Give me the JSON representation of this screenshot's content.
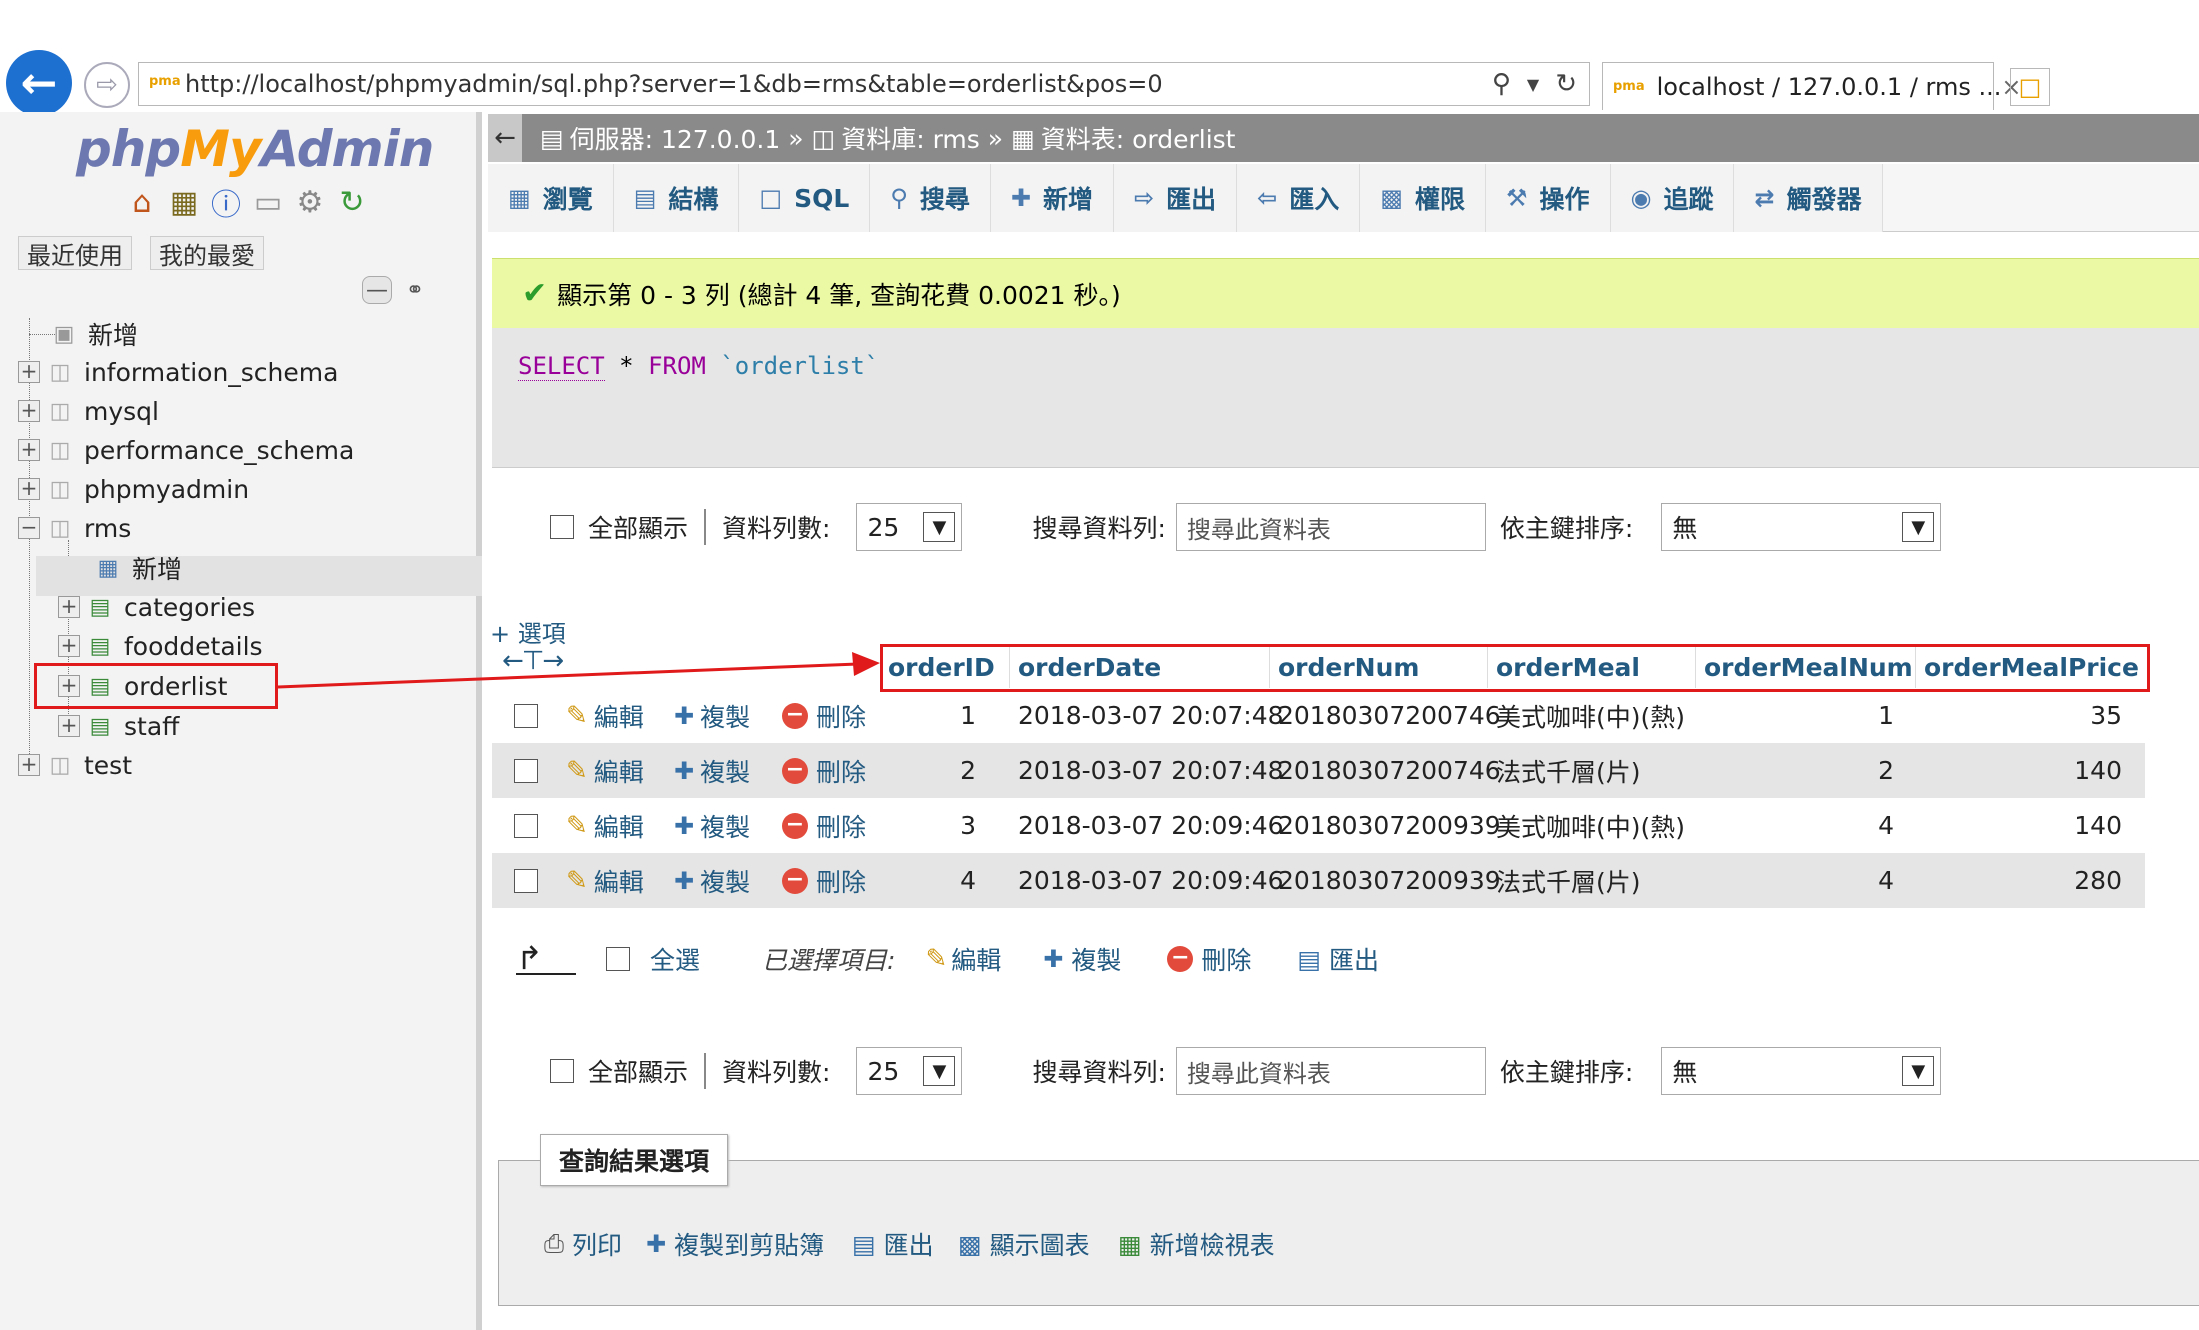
{
  "browser": {
    "url": "http://localhost/phpmyadmin/sql.php?server=1&db=rms&table=orderlist&pos=0",
    "tab_title": "localhost / 127.0.0.1 / rms ...",
    "tab_close": "×"
  },
  "nav": {
    "logo_php": "php",
    "logo_my": "My",
    "logo_admin": "Admin",
    "recent": "最近使用",
    "favorites": "我的最愛",
    "tree": [
      {
        "label": "新增"
      },
      {
        "label": "information_schema"
      },
      {
        "label": "mysql"
      },
      {
        "label": "performance_schema"
      },
      {
        "label": "phpmyadmin"
      },
      {
        "label": "rms"
      },
      {
        "label": "新增"
      },
      {
        "label": "categories"
      },
      {
        "label": "fooddetails"
      },
      {
        "label": "orderlist"
      },
      {
        "label": "staff"
      },
      {
        "label": "test"
      }
    ]
  },
  "breadcrumb": {
    "server": "伺服器: 127.0.0.1",
    "database": "資料庫: rms",
    "table": "資料表: orderlist",
    "sep": "»"
  },
  "tabs": [
    "瀏覽",
    "結構",
    "SQL",
    "搜尋",
    "新增",
    "匯出",
    "匯入",
    "權限",
    "操作",
    "追蹤",
    "觸發器"
  ],
  "message": "顯示第 0 - 3 列 (總計 4 筆, 查詢花費 0.0021 秒。)",
  "sql": {
    "select": "SELECT",
    "star": " * ",
    "from": "FROM",
    "table": " `orderlist`"
  },
  "controls": {
    "show_all": "全部顯示",
    "rows_label": "資料列數:",
    "rows_value": "25",
    "search_label": "搜尋資料列:",
    "search_placeholder": "搜尋此資料表",
    "sort_label": "依主鍵排序:",
    "sort_value": "無"
  },
  "options_link": "+ 選項",
  "columns": [
    "orderID",
    "orderDate",
    "orderNum",
    "orderMeal",
    "orderMealNum",
    "orderMealPrice"
  ],
  "row_actions": {
    "edit": "編輯",
    "copy": "複製",
    "delete": "刪除"
  },
  "rows": [
    {
      "orderID": "1",
      "orderDate": "2018-03-07 20:07:48",
      "orderNum": "20180307200746",
      "orderMeal": "美式咖啡(中)(熱)",
      "orderMealNum": "1",
      "orderMealPrice": "35"
    },
    {
      "orderID": "2",
      "orderDate": "2018-03-07 20:07:48",
      "orderNum": "20180307200746",
      "orderMeal": "法式千層(片)",
      "orderMealNum": "2",
      "orderMealPrice": "140"
    },
    {
      "orderID": "3",
      "orderDate": "2018-03-07 20:09:46",
      "orderNum": "20180307200939",
      "orderMeal": "美式咖啡(中)(熱)",
      "orderMealNum": "4",
      "orderMealPrice": "140"
    },
    {
      "orderID": "4",
      "orderDate": "2018-03-07 20:09:46",
      "orderNum": "20180307200939",
      "orderMeal": "法式千層(片)",
      "orderMealNum": "4",
      "orderMealPrice": "280"
    }
  ],
  "bulk": {
    "select_all": "全選",
    "with_selected": "已選擇項目:",
    "edit": "編輯",
    "copy": "複製",
    "delete": "刪除",
    "export": "匯出"
  },
  "query_results": {
    "legend": "查詢結果選項",
    "print": "列印",
    "copy_clipboard": "複製到剪貼簿",
    "export": "匯出",
    "chart": "顯示圖表",
    "create_view": "新增檢視表"
  },
  "colors": {
    "link": "#235a81",
    "annotation": "#e01a1a",
    "success_bg": "#ebf8a4"
  }
}
